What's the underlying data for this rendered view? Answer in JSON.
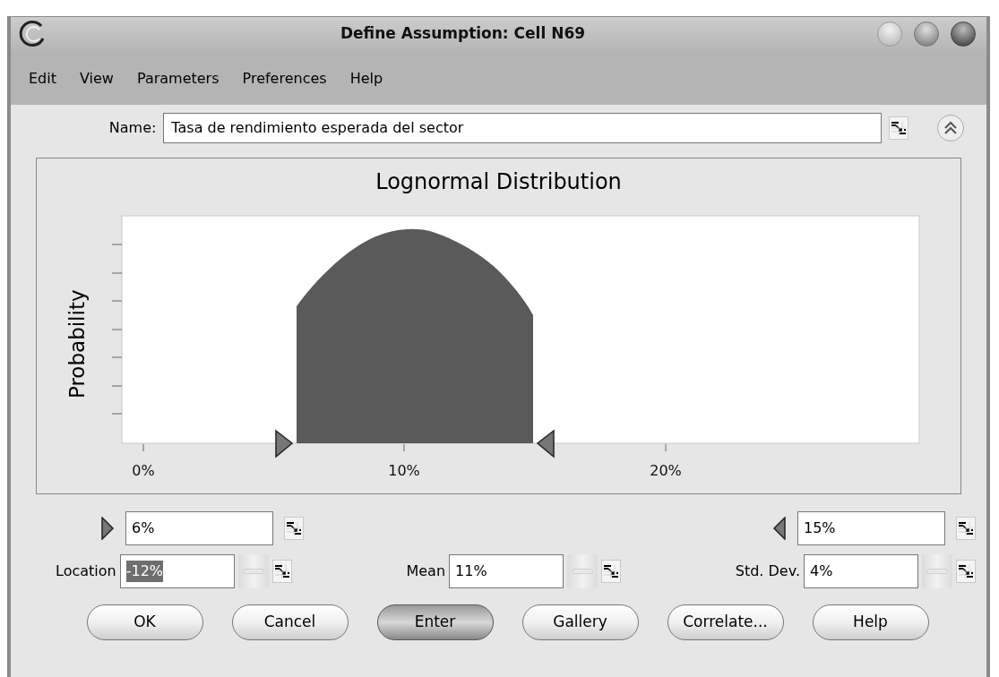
{
  "window": {
    "title": "Define Assumption: Cell N69"
  },
  "menu": [
    "Edit",
    "View",
    "Parameters",
    "Preferences",
    "Help"
  ],
  "name_field": {
    "label": "Name:",
    "value": "Tasa de rendimiento esperada del sector"
  },
  "chart": {
    "title": "Lognormal Distribution",
    "ylabel": "Probability",
    "xtick_labels": [
      "0%",
      "10%",
      "20%"
    ]
  },
  "bounds": [
    {
      "kind": "min",
      "value": "6%"
    },
    {
      "kind": "max",
      "value": "15%"
    }
  ],
  "parameters": [
    {
      "label": "Location",
      "value": "-12%",
      "selected": true
    },
    {
      "label": "Mean",
      "value": "11%",
      "selected": false
    },
    {
      "label": "Std. Dev.",
      "value": "4%",
      "selected": false
    }
  ],
  "buttons": [
    {
      "label": "OK",
      "selected": false
    },
    {
      "label": "Cancel",
      "selected": false
    },
    {
      "label": "Enter",
      "selected": true
    },
    {
      "label": "Gallery",
      "selected": false
    },
    {
      "label": "Correlate...",
      "selected": false
    },
    {
      "label": "Help",
      "selected": false
    }
  ]
}
